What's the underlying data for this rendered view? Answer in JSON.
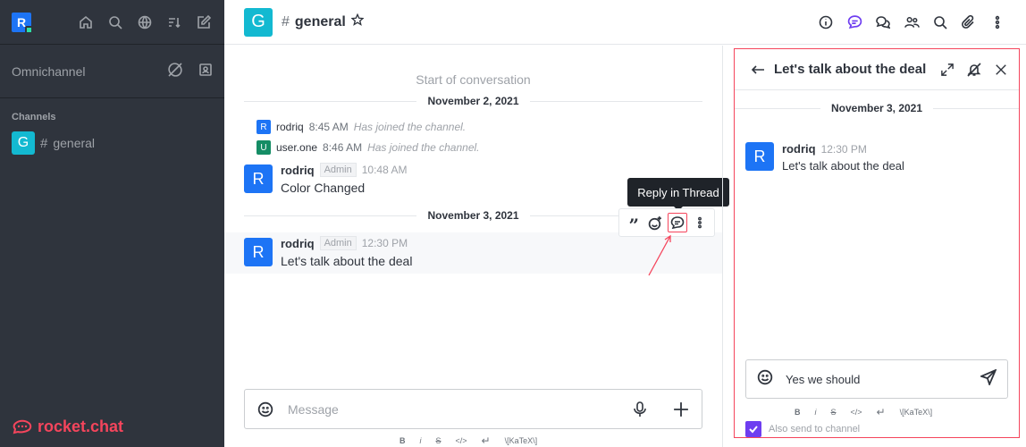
{
  "sidebar": {
    "avatar_letter": "R",
    "omnichannel_label": "Omnichannel",
    "section_label": "Channels",
    "channel": {
      "avatar_letter": "G",
      "name": "general"
    },
    "logo_text": "rocket.chat"
  },
  "header": {
    "avatar_letter": "G",
    "room_name": "general"
  },
  "main": {
    "start_label": "Start of conversation",
    "date_1": "November 2, 2021",
    "date_2": "November 3, 2021",
    "system_messages": [
      {
        "avatar_letter": "R",
        "avatar_color": "#1d74f5",
        "user": "rodriq",
        "time": "8:45 AM",
        "text": "Has joined the channel."
      },
      {
        "avatar_letter": "U",
        "avatar_color": "#158d65",
        "user": "user.one",
        "time": "8:46 AM",
        "text": "Has joined the channel."
      }
    ],
    "messages": [
      {
        "avatar_letter": "R",
        "user": "rodriq",
        "role": "Admin",
        "time": "10:48 AM",
        "text": "Color Changed"
      },
      {
        "avatar_letter": "R",
        "user": "rodriq",
        "role": "Admin",
        "time": "12:30 PM",
        "text": "Let's talk about the deal"
      }
    ],
    "tooltip": "Reply in Thread",
    "composer_placeholder": "Message",
    "format_bar": {
      "bold": "B",
      "italic": "i",
      "strike": "S",
      "code": "</>",
      "katex": "\\[KaTeX\\]"
    }
  },
  "thread": {
    "title": "Let's talk about the deal",
    "date": "November 3, 2021",
    "message": {
      "avatar_letter": "R",
      "user": "rodriq",
      "time": "12:30 PM",
      "text": "Let's talk about the deal"
    },
    "composer_value": "Yes we should",
    "format_bar": {
      "bold": "B",
      "italic": "i",
      "strike": "S",
      "code": "</>",
      "katex": "\\[KaTeX\\]"
    },
    "also_send_label": "Also send to channel",
    "also_send_checked": true
  },
  "colors": {
    "accent": "#6e3df0",
    "highlight": "#f5455c",
    "sidebar_bg": "#2f343d",
    "avatar_blue": "#1d74f5",
    "channel_teal": "#13b9d1"
  }
}
